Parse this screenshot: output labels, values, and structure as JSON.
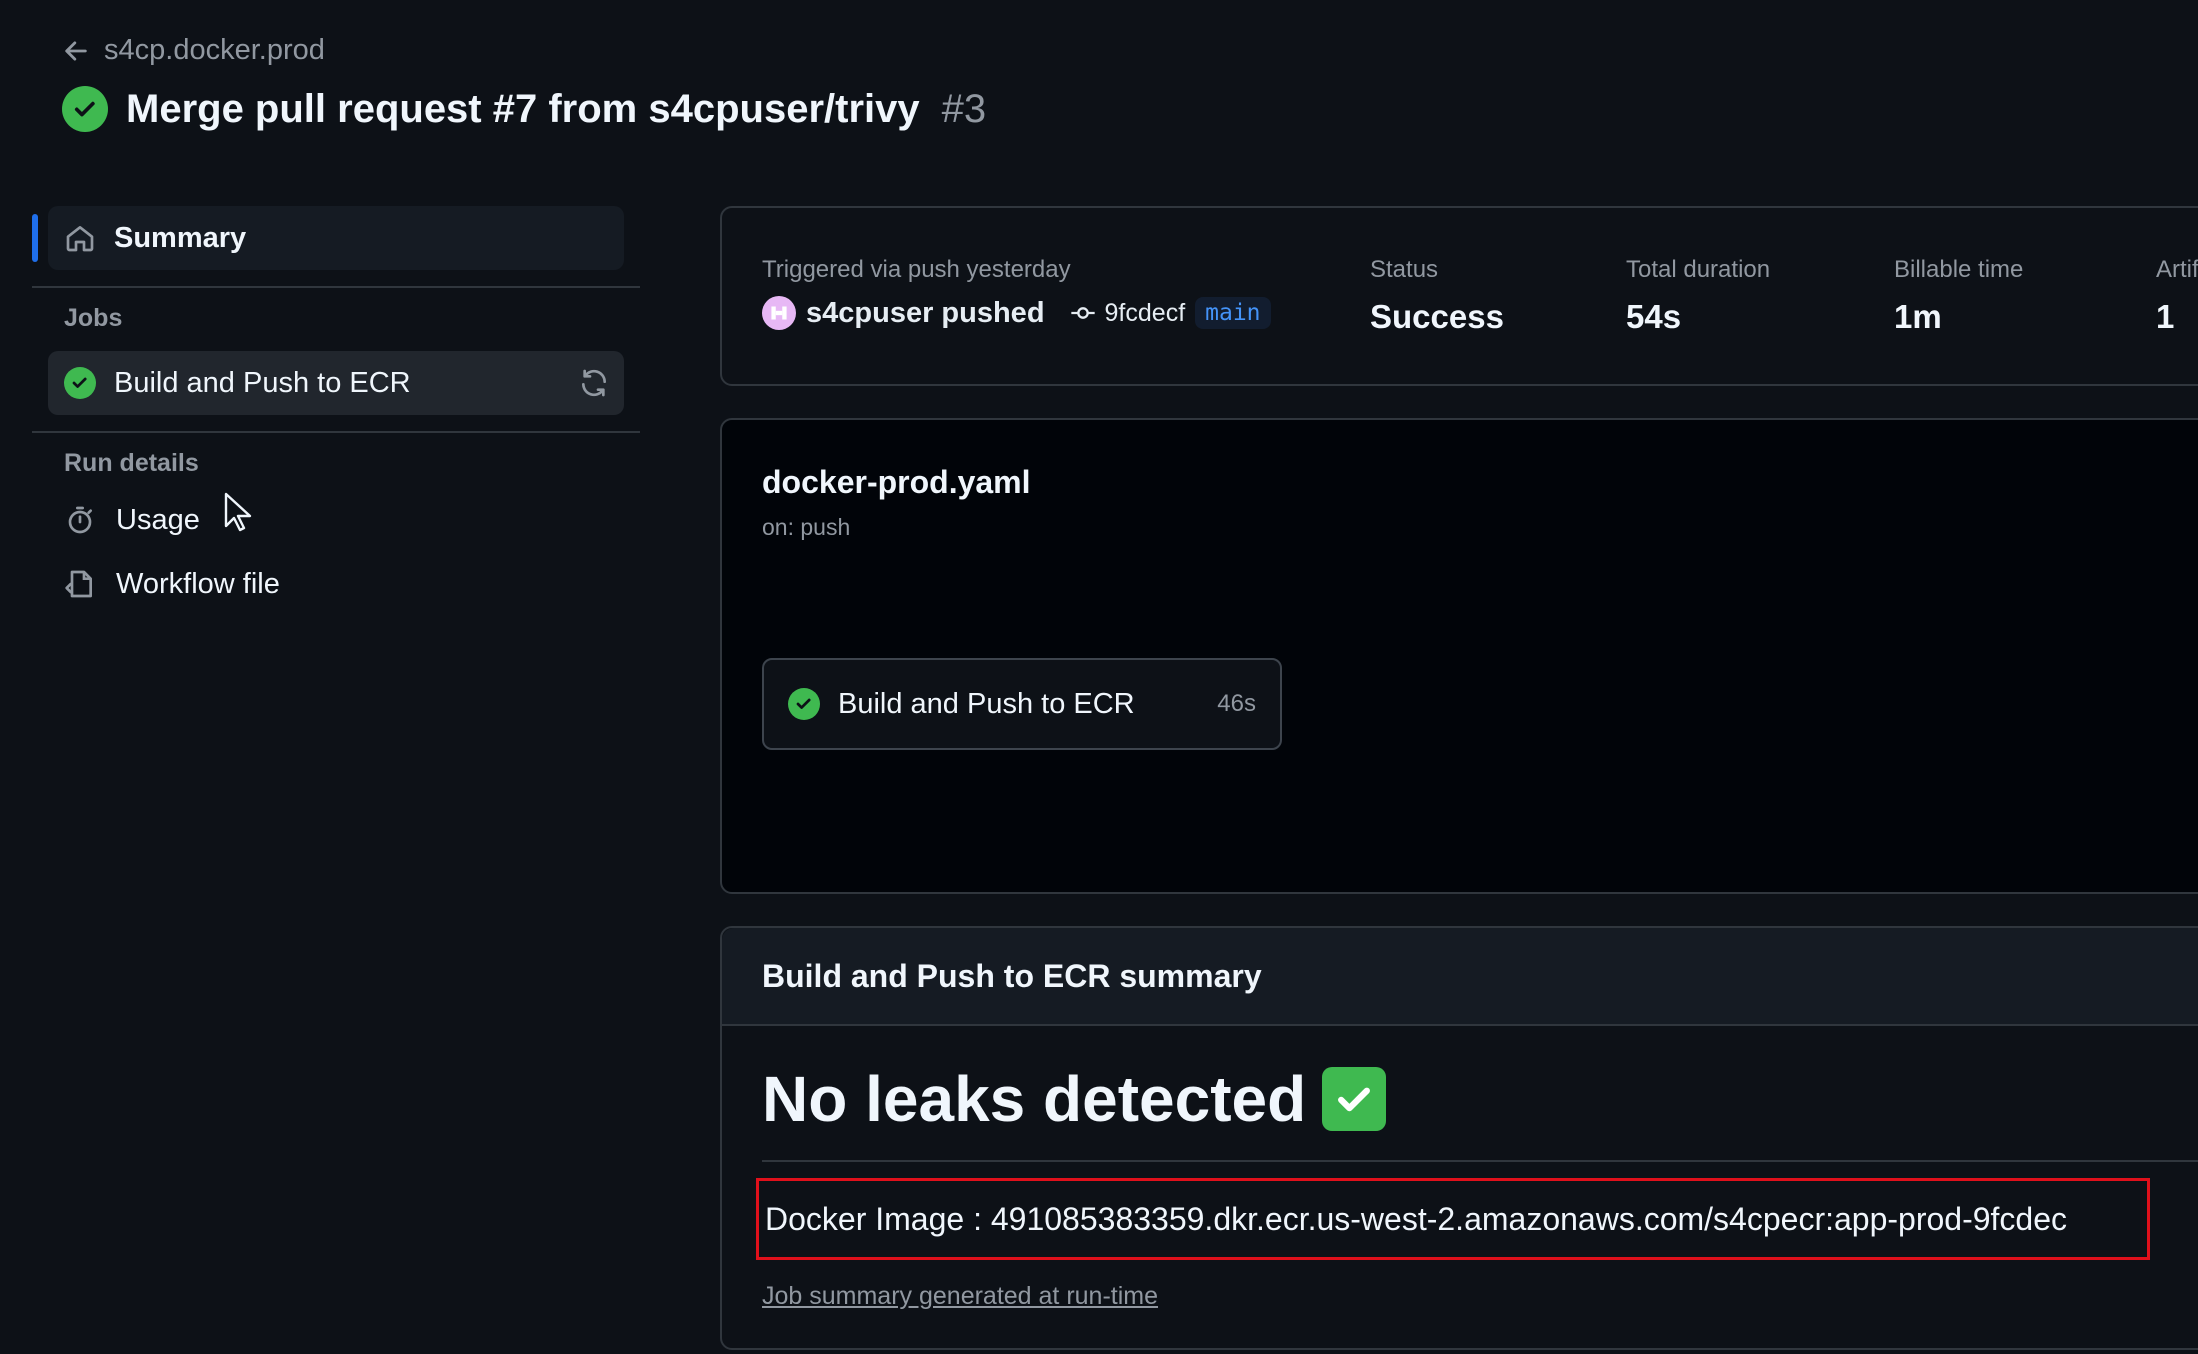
{
  "header": {
    "back_label": "s4cp.docker.prod",
    "title": "Merge pull request #7 from s4cpuser/trivy",
    "run_number": "#3"
  },
  "sidebar": {
    "summary_label": "Summary",
    "jobs_heading": "Jobs",
    "job_label": "Build and Push to ECR",
    "run_details_heading": "Run details",
    "usage_label": "Usage",
    "workflow_file_label": "Workflow file"
  },
  "run_meta": {
    "trigger_label": "Triggered via push yesterday",
    "actor": "s4cpuser pushed",
    "commit": "9fcdecf",
    "branch": "main",
    "status_label": "Status",
    "status_value": "Success",
    "duration_label": "Total duration",
    "duration_value": "54s",
    "billable_label": "Billable time",
    "billable_value": "1m",
    "artifacts_label": "Artifacts",
    "artifacts_value": "1"
  },
  "graph": {
    "workflow_name": "docker-prod.yaml",
    "trigger": "on: push",
    "job_label": "Build and Push to ECR",
    "job_duration": "46s"
  },
  "job_summary": {
    "heading": "Build and Push to ECR summary",
    "leaks_text": "No leaks detected",
    "docker_image": "Docker Image : 491085383359.dkr.ecr.us-west-2.amazonaws.com/s4cpecr:app-prod-9fcdec",
    "footer_link": "Job summary generated at run-time"
  },
  "colors": {
    "background": "#0d1117",
    "success": "#3fb950",
    "accent": "#1f6feb",
    "highlight_border": "#e0101b"
  }
}
